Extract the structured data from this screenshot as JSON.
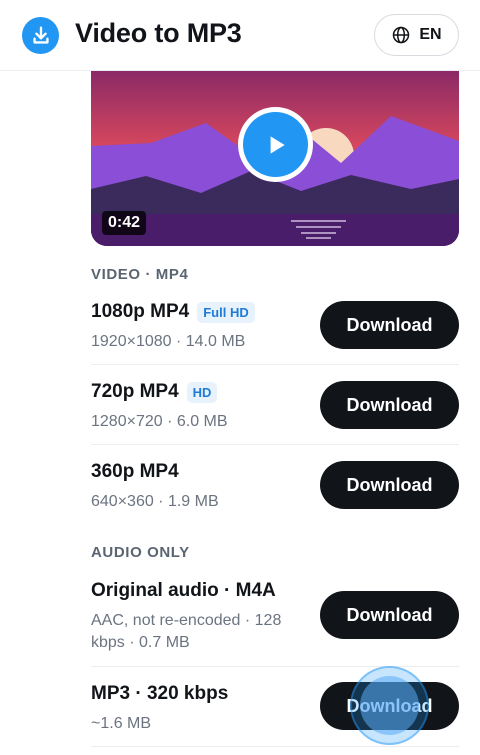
{
  "header": {
    "logo_icon": "download-circle-icon",
    "title": "Video to MP3",
    "language_icon": "globe-icon",
    "language_label": "EN"
  },
  "video": {
    "duration": "0:42",
    "play_icon": "play-icon"
  },
  "sections": {
    "video_label": "VIDEO · MP4",
    "audio_label": "AUDIO ONLY"
  },
  "video_options": [
    {
      "format": "1080p MP4",
      "badge": "Full HD",
      "meta": "1920×1080 · 14.0 MB",
      "button": "Download"
    },
    {
      "format": "720p MP4",
      "badge": "HD",
      "meta": "1280×720 · 6.0 MB",
      "button": "Download"
    },
    {
      "format": "360p MP4",
      "badge": "",
      "meta": "640×360 · 1.9 MB",
      "button": "Download"
    }
  ],
  "audio_options": [
    {
      "format": "Original audio · M4A",
      "meta": "AAC, not re-encoded · 128 kbps · 0.7 MB",
      "button": "Download"
    },
    {
      "format": "MP3 · 320 kbps",
      "meta": "~1.6 MB",
      "button": "Download"
    }
  ],
  "colors": {
    "accent": "#2196f3",
    "button_bg": "#111418",
    "badge_text": "#1e7bd6",
    "badge_bg": "#e8f2fd"
  }
}
